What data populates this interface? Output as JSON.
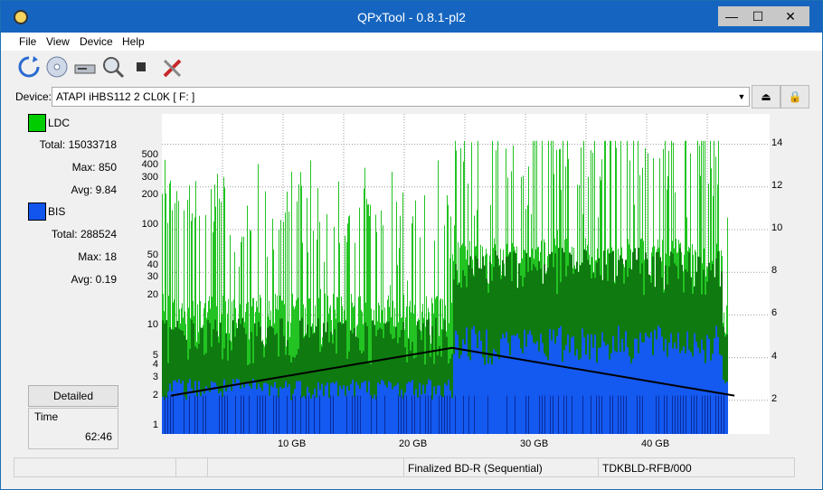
{
  "window": {
    "title": "QPxTool - 0.8.1-pl2",
    "min": "—",
    "max": "☐",
    "close": "✕"
  },
  "menu": [
    "File",
    "View",
    "Device",
    "Help"
  ],
  "device": {
    "label": "Device:",
    "value": "ATAPI   iHBS112   2     CL0K [ F: ]"
  },
  "left": {
    "ldc": {
      "name": "LDC",
      "color": "#00cc00",
      "total_label": "Total:",
      "total": "15033718",
      "max_label": "Max:",
      "max": "850",
      "avg_label": "Avg:",
      "avg": "9.84"
    },
    "bis": {
      "name": "BIS",
      "color": "#1155ee",
      "total_label": "Total:",
      "total": "288524",
      "max_label": "Max:",
      "max": "18",
      "avg_label": "Avg:",
      "avg": "0.19"
    },
    "detailed_button": "Detailed",
    "time_label": "Time",
    "time_value": "62:46"
  },
  "chart_data": {
    "type": "area",
    "series": [
      {
        "name": "LDC"
      },
      {
        "name": "BIS"
      }
    ],
    "y_ticks_left": [
      "500",
      "400",
      "300",
      "200",
      "100",
      "50",
      "40",
      "30",
      "20",
      "10",
      "5",
      "4",
      "3",
      "2",
      "1"
    ],
    "y_ticks_right": [
      "14",
      "12",
      "10",
      "8",
      "6",
      "4",
      "2"
    ],
    "x_ticks": [
      "10 GB",
      "20 GB",
      "30 GB",
      "40 GB"
    ],
    "y_scale": "log",
    "xlim": [
      0,
      50
    ],
    "speed_curve": {
      "x": [
        0,
        23.2,
        46.5
      ],
      "y": [
        2.0,
        4.0,
        2.0
      ]
    }
  },
  "status": {
    "disc": "Finalized BD-R (Sequential)",
    "media_id": "TDKBLD-RFB/000"
  }
}
